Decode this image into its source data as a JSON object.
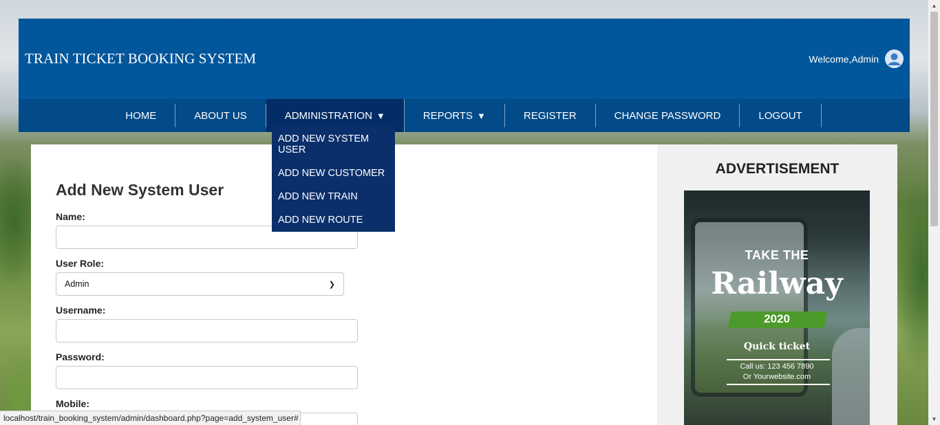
{
  "header": {
    "site_title": "TRAIN TICKET BOOKING SYSTEM",
    "welcome_text": "Welcome,Admin",
    "avatar_icon": "user-avatar-icon"
  },
  "nav": {
    "items": [
      {
        "label": "HOME"
      },
      {
        "label": "ABOUT US"
      },
      {
        "label": "ADMINISTRATION",
        "caret": "▼"
      },
      {
        "label": "REPORTS",
        "caret": "▼"
      },
      {
        "label": "REGISTER"
      },
      {
        "label": "CHANGE PASSWORD"
      },
      {
        "label": "LOGOUT"
      }
    ],
    "dropdown": [
      {
        "label": "ADD NEW SYSTEM USER"
      },
      {
        "label": "ADD NEW CUSTOMER"
      },
      {
        "label": "ADD NEW TRAIN"
      },
      {
        "label": "ADD NEW ROUTE"
      }
    ]
  },
  "form": {
    "title": "Add New System User",
    "name_label": "Name:",
    "name_value": "",
    "role_label": "User Role:",
    "role_selected": "Admin",
    "username_label": "Username:",
    "username_value": "",
    "password_label": "Password:",
    "password_value": "",
    "mobile_label": "Mobile:"
  },
  "sidebar": {
    "title": "ADVERTISEMENT",
    "ad": {
      "line1": "TAKE THE",
      "line2": "Railway",
      "line3": "2020",
      "line4": "Quick ticket",
      "line5": "Call us: 123 456 7890",
      "line6": "Or Yourwebsite.com"
    }
  },
  "status_bar": {
    "url": "localhost/train_booking_system/admin/dashboard.php?page=add_system_user#"
  },
  "colors": {
    "header_bg": "#02569b",
    "nav_bg": "#024a88",
    "dropdown_bg": "#0a2f6a"
  }
}
